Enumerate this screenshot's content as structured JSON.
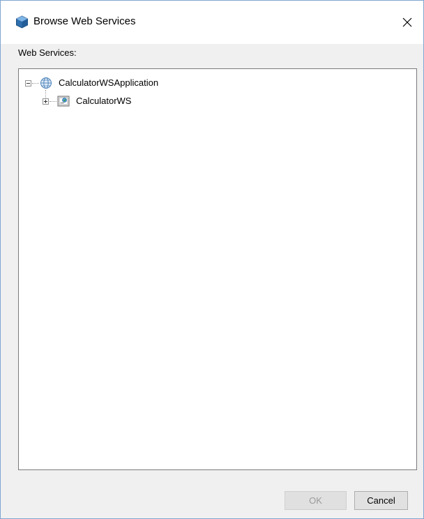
{
  "window": {
    "title": "Browse Web Services",
    "close_label": "×",
    "title_icon": "netbeans-cube-icon"
  },
  "main": {
    "section_label": "Web Services:"
  },
  "tree": {
    "nodes": [
      {
        "label": "CalculatorWSApplication",
        "icon": "globe-icon",
        "expanded": true,
        "level": 0
      },
      {
        "label": "CalculatorWS",
        "icon": "web-service-icon",
        "expanded": false,
        "level": 1
      }
    ]
  },
  "buttons": {
    "ok_label": "OK",
    "ok_enabled": false,
    "cancel_label": "Cancel"
  },
  "colors": {
    "accent_border": "#7ea6d1",
    "background": "#f0f0f0",
    "panel": "#ffffff",
    "disabled_text": "#9a9a9a"
  }
}
